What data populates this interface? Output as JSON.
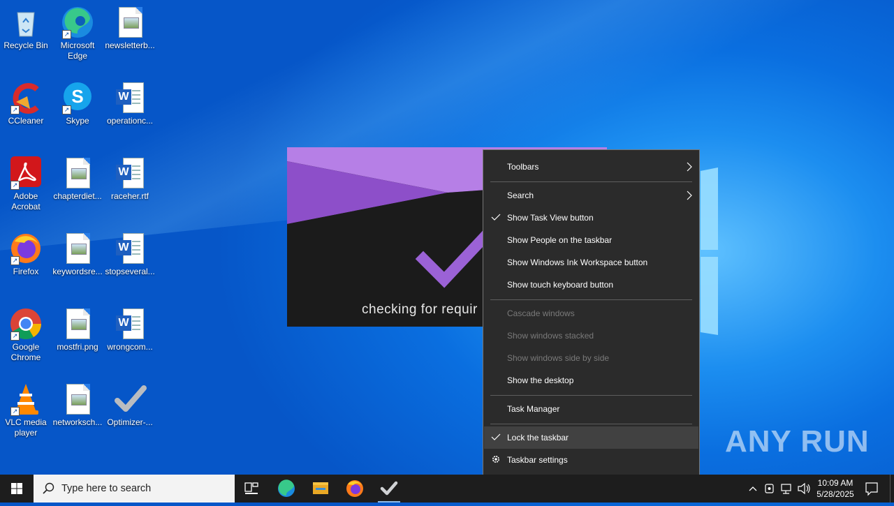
{
  "desktop_icons": [
    {
      "label": "Recycle Bin",
      "icon": "recycle-bin-icon"
    },
    {
      "label": "Microsoft Edge",
      "icon": "edge-icon"
    },
    {
      "label": "newsletterb...",
      "icon": "image-file-icon"
    },
    {
      "label": "CCleaner",
      "icon": "ccleaner-icon"
    },
    {
      "label": "Skype",
      "icon": "skype-icon"
    },
    {
      "label": "operationc...",
      "icon": "word-doc-icon"
    },
    {
      "label": "Adobe Acrobat",
      "icon": "acrobat-icon"
    },
    {
      "label": "chapterdiet...",
      "icon": "image-file-icon"
    },
    {
      "label": "raceher.rtf",
      "icon": "word-doc-icon"
    },
    {
      "label": "Firefox",
      "icon": "firefox-icon"
    },
    {
      "label": "keywordsre...",
      "icon": "image-file-icon"
    },
    {
      "label": "stopseveral...",
      "icon": "word-doc-icon"
    },
    {
      "label": "Google Chrome",
      "icon": "chrome-icon"
    },
    {
      "label": "mostfri.png",
      "icon": "image-file-icon"
    },
    {
      "label": "wrongcom...",
      "icon": "word-doc-icon"
    },
    {
      "label": "VLC media player",
      "icon": "vlc-icon"
    },
    {
      "label": "networksch...",
      "icon": "image-file-icon"
    },
    {
      "label": "Optimizer-...",
      "icon": "checkmark-app-icon"
    }
  ],
  "splash": {
    "status_text": "checking for requir"
  },
  "context_menu": {
    "items": [
      {
        "label": "Toolbars",
        "submenu": true
      },
      {
        "label": "Search",
        "submenu": true
      },
      {
        "label": "Show Task View button",
        "checked": true
      },
      {
        "label": "Show People on the taskbar"
      },
      {
        "label": "Show Windows Ink Workspace button"
      },
      {
        "label": "Show touch keyboard button"
      },
      {
        "label": "Cascade windows",
        "disabled": true
      },
      {
        "label": "Show windows stacked",
        "disabled": true
      },
      {
        "label": "Show windows side by side",
        "disabled": true
      },
      {
        "label": "Show the desktop"
      },
      {
        "label": "Task Manager"
      },
      {
        "label": "Lock the taskbar",
        "checked": true,
        "highlighted": true
      },
      {
        "label": "Taskbar settings",
        "icon": "gear-icon"
      }
    ]
  },
  "taskbar": {
    "search_placeholder": "Type here to search",
    "pinned": [
      "task-view-icon",
      "edge-icon",
      "file-explorer-icon",
      "firefox-icon",
      "optimizer-icon"
    ],
    "clock_time": "10:09 AM",
    "clock_date": "5/28/2025"
  },
  "watermark": "ANY RUN",
  "colors": {
    "menu_bg": "#2b2b2b",
    "taskbar_bg": "#1d1d1d",
    "splash_purple": "#9a5bd0"
  }
}
